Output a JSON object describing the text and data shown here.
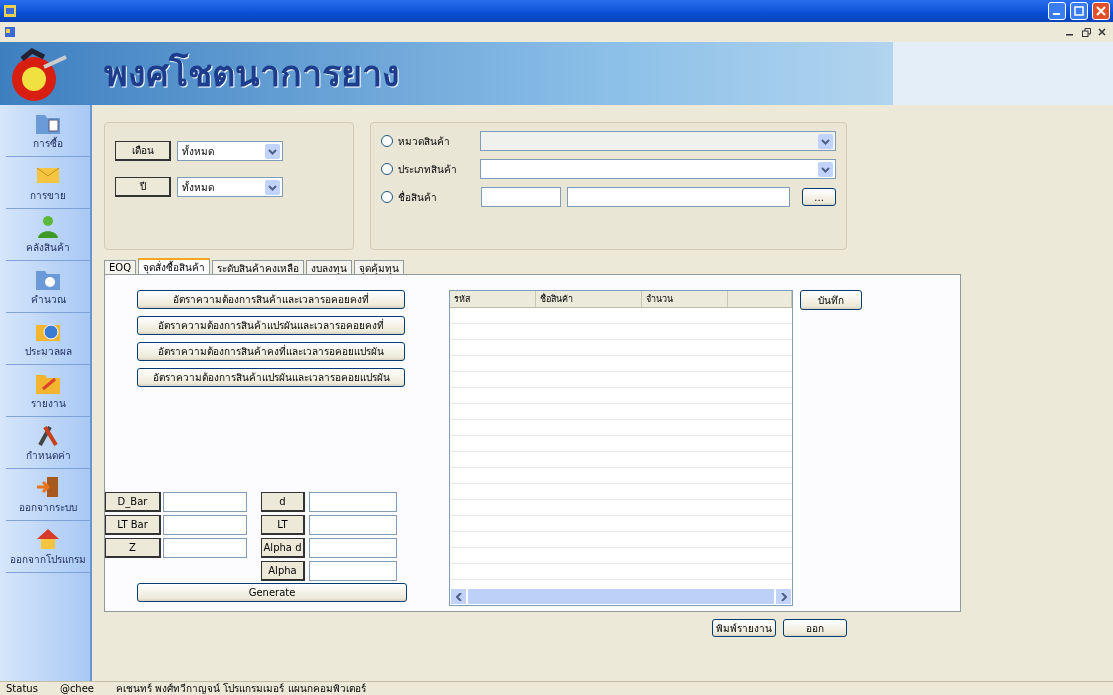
{
  "banner": {
    "title": "พงศโชตนาการยาง"
  },
  "sidebar": {
    "items": [
      {
        "label": "การซื้อ"
      },
      {
        "label": "การขาย"
      },
      {
        "label": "คลังสินค้า"
      },
      {
        "label": "คำนวณ"
      },
      {
        "label": "ประมวลผล"
      },
      {
        "label": "รายงาน"
      },
      {
        "label": "กำหนดค่า"
      },
      {
        "label": "ออกจากระบบ"
      },
      {
        "label": "ออกจากโปรแกรม"
      }
    ]
  },
  "period_filter": [
    {
      "label": "เดือน",
      "value": "ทั้งหมด"
    },
    {
      "label": "ปี",
      "value": "ทั้งหมด"
    }
  ],
  "product_filter": [
    {
      "kind": "dropdown",
      "label": "หมวดสินค้า",
      "selected": false
    },
    {
      "kind": "dropdown",
      "label": "ประเภทสินค้า",
      "selected": false
    },
    {
      "kind": "search",
      "label": "ชื่อสินค้า",
      "selected": false,
      "button": "..."
    }
  ],
  "tabs": [
    {
      "label": "EOQ",
      "selected": false
    },
    {
      "label": "จุดสั่งซื้อสินค้า",
      "selected": true
    },
    {
      "label": "ระดับสินค้าคงเหลือ",
      "selected": false
    },
    {
      "label": "งบลงทุน",
      "selected": false
    },
    {
      "label": "จุดคุ้มทุน",
      "selected": false
    }
  ],
  "model_buttons": [
    "อัตราความต้องการสินค้าและเวลารอคอยคงที่",
    "อัตราความต้องการสินค้าแปรผันและเวลารอคอยคงที่",
    "อัตราความต้องการสินค้าคงที่และเวลารอคอยแปรผัน",
    "อัตราความต้องการสินค้าแปรผันและเวลารอคอยแปรผัน"
  ],
  "parameters_left": [
    "D_Bar",
    "LT Bar",
    "Z"
  ],
  "parameters_right": [
    "d",
    "LT",
    "Alpha d",
    "Alpha"
  ],
  "generate_button": "Generate",
  "table": {
    "columns": [
      "รหัส",
      "ชื่อสินค้า",
      "จำนวน",
      ""
    ]
  },
  "save_button": "บันทึก",
  "footer_buttons": [
    "พิมพ์รายงาน",
    "ออก"
  ],
  "status_bar": [
    "Status",
    "@chee",
    "คเชนทร์ พงศ์ทวีกาญจน์  โปรแกรมเมอร์  แผนกคอมพิวเตอร์"
  ]
}
